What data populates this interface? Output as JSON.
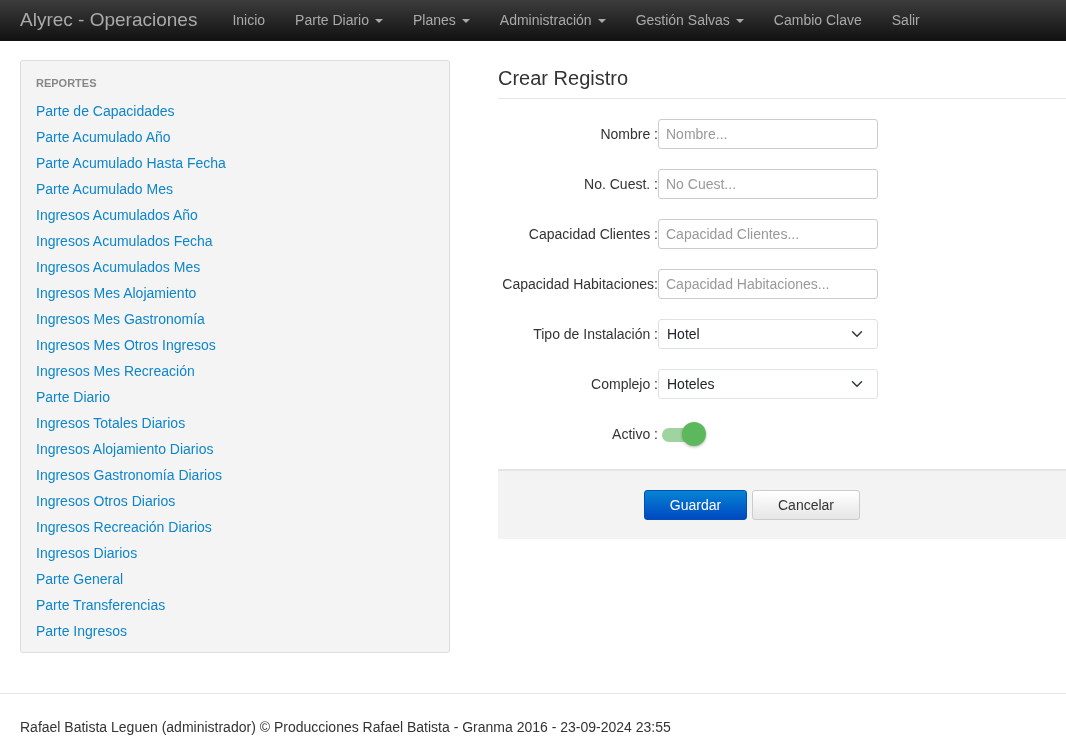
{
  "navbar": {
    "brand": "Alyrec - Operaciones",
    "items": [
      {
        "label": "Inicio",
        "dropdown": false
      },
      {
        "label": "Parte Diario",
        "dropdown": true
      },
      {
        "label": "Planes",
        "dropdown": true
      },
      {
        "label": "Administración",
        "dropdown": true
      },
      {
        "label": "Gestión Salvas",
        "dropdown": true
      },
      {
        "label": "Cambio Clave",
        "dropdown": false
      },
      {
        "label": "Salir",
        "dropdown": false
      }
    ]
  },
  "sidebar": {
    "heading": "REPORTES",
    "items": [
      "Parte de Capacidades",
      "Parte Acumulado Año",
      "Parte Acumulado Hasta Fecha",
      "Parte Acumulado Mes",
      "Ingresos Acumulados Año",
      "Ingresos Acumulados Fecha",
      "Ingresos Acumulados Mes",
      "Ingresos Mes Alojamiento",
      "Ingresos Mes Gastronomía",
      "Ingresos Mes Otros Ingresos",
      "Ingresos Mes Recreación",
      "Parte Diario",
      "Ingresos Totales Diarios",
      "Ingresos Alojamiento Diarios",
      "Ingresos Gastronomía Diarios",
      "Ingresos Otros Diarios",
      "Ingresos Recreación Diarios",
      "Ingresos Diarios",
      "Parte General",
      "Parte Transferencias",
      "Parte Ingresos"
    ]
  },
  "form": {
    "title": "Crear Registro",
    "fields": [
      {
        "kind": "text",
        "label": "Nombre :",
        "placeholder": "Nombre..."
      },
      {
        "kind": "text",
        "label": "No. Cuest. :",
        "placeholder": "No Cuest..."
      },
      {
        "kind": "text",
        "label": "Capacidad Clientes :",
        "placeholder": "Capacidad Clientes..."
      },
      {
        "kind": "text",
        "label": "Capacidad Habitaciones:",
        "placeholder": "Capacidad Habitaciones..."
      },
      {
        "kind": "select",
        "label": "Tipo de Instalación :",
        "value": "Hotel"
      },
      {
        "kind": "select",
        "label": "Complejo :",
        "value": "Hoteles"
      },
      {
        "kind": "switch",
        "label": "Activo :",
        "on": true
      }
    ],
    "buttons": [
      {
        "kind": "primary",
        "label": "Guardar"
      },
      {
        "kind": "default",
        "label": "Cancelar"
      }
    ]
  },
  "footer": "Rafael Batista Leguen (administrador) © Producciones Rafael Batista - Granma 2016 - 23-09-2024 23:55"
}
